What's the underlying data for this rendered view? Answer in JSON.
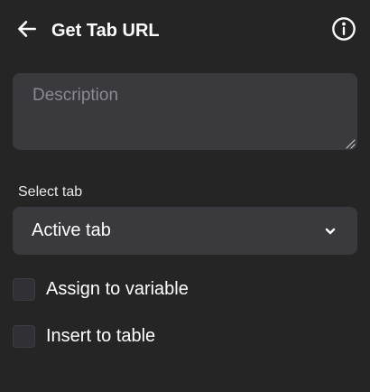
{
  "header": {
    "title": "Get Tab URL",
    "back_icon": "arrow-left-icon",
    "info_icon": "info-circle-icon"
  },
  "description": {
    "placeholder": "Description",
    "value": ""
  },
  "select_tab": {
    "label": "Select tab",
    "value": "Active tab",
    "icon": "chevron-down-icon"
  },
  "options": {
    "assign_label": "Assign to variable",
    "assign_checked": false,
    "insert_label": "Insert to table",
    "insert_checked": false
  },
  "colors": {
    "background": "#252526",
    "field": "#3a393e",
    "text": "#ffffff",
    "placeholder": "#8b8a90"
  }
}
